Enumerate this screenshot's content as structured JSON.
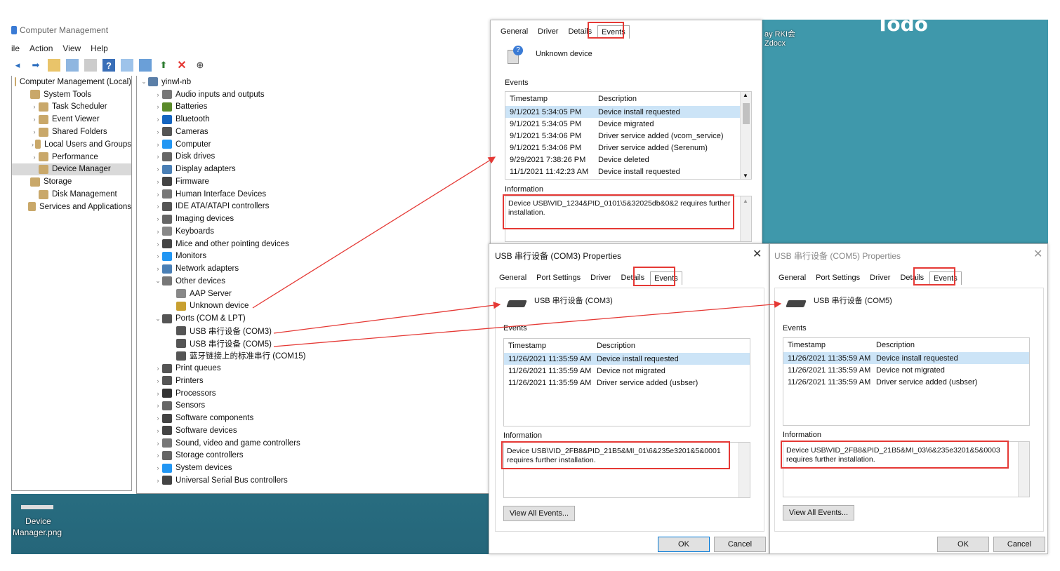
{
  "desktop": {
    "todo": "Todo",
    "icon_label_1": "Device",
    "icon_label_2": "Manager.png",
    "side_text_1": "ay RKI会",
    "side_text_2": "Zdocx"
  },
  "cm": {
    "title": "Computer Management",
    "menu": [
      "ile",
      "Action",
      "View",
      "Help"
    ],
    "left_tree": [
      {
        "label": "Computer Management (Local)",
        "indent": 0,
        "icon": "computer-management-icon"
      },
      {
        "label": "System Tools",
        "indent": 1,
        "icon": "tools-icon"
      },
      {
        "label": "Task Scheduler",
        "indent": 2,
        "icon": "clock-icon",
        "chev": "›"
      },
      {
        "label": "Event Viewer",
        "indent": 2,
        "icon": "event-viewer-icon",
        "chev": "›"
      },
      {
        "label": "Shared Folders",
        "indent": 2,
        "icon": "shared-folder-icon",
        "chev": "›"
      },
      {
        "label": "Local Users and Groups",
        "indent": 2,
        "icon": "users-icon",
        "chev": "›"
      },
      {
        "label": "Performance",
        "indent": 2,
        "icon": "performance-icon",
        "chev": "›"
      },
      {
        "label": "Device Manager",
        "indent": 2,
        "icon": "device-manager-icon",
        "selected": true
      },
      {
        "label": "Storage",
        "indent": 1,
        "icon": "storage-icon"
      },
      {
        "label": "Disk Management",
        "indent": 2,
        "icon": "disk-icon"
      },
      {
        "label": "Services and Applications",
        "indent": 1,
        "icon": "services-icon"
      }
    ],
    "right_tree": [
      {
        "label": "yinwl-nb",
        "indent": 0,
        "chev": "⌄",
        "color": "#5b7fa8"
      },
      {
        "label": "Audio inputs and outputs",
        "indent": 1,
        "chev": "›",
        "color": "#777"
      },
      {
        "label": "Batteries",
        "indent": 1,
        "chev": "›",
        "color": "#5a8a2a"
      },
      {
        "label": "Bluetooth",
        "indent": 1,
        "chev": "›",
        "color": "#1565c0"
      },
      {
        "label": "Cameras",
        "indent": 1,
        "chev": "›",
        "color": "#555"
      },
      {
        "label": "Computer",
        "indent": 1,
        "chev": "›",
        "color": "#2196f3"
      },
      {
        "label": "Disk drives",
        "indent": 1,
        "chev": "›",
        "color": "#666"
      },
      {
        "label": "Display adapters",
        "indent": 1,
        "chev": "›",
        "color": "#4a7fb5"
      },
      {
        "label": "Firmware",
        "indent": 1,
        "chev": "›",
        "color": "#444"
      },
      {
        "label": "Human Interface Devices",
        "indent": 1,
        "chev": "›",
        "color": "#777"
      },
      {
        "label": "IDE ATA/ATAPI controllers",
        "indent": 1,
        "chev": "›",
        "color": "#555"
      },
      {
        "label": "Imaging devices",
        "indent": 1,
        "chev": "›",
        "color": "#666"
      },
      {
        "label": "Keyboards",
        "indent": 1,
        "chev": "›",
        "color": "#888"
      },
      {
        "label": "Mice and other pointing devices",
        "indent": 1,
        "chev": "›",
        "color": "#444"
      },
      {
        "label": "Monitors",
        "indent": 1,
        "chev": "›",
        "color": "#2196f3"
      },
      {
        "label": "Network adapters",
        "indent": 1,
        "chev": "›",
        "color": "#4a7fb5"
      },
      {
        "label": "Other devices",
        "indent": 1,
        "chev": "⌄",
        "color": "#777"
      },
      {
        "label": "AAP Server",
        "indent": 2,
        "chev": "",
        "color": "#888"
      },
      {
        "label": "Unknown device",
        "indent": 2,
        "chev": "",
        "color": "#c8a030"
      },
      {
        "label": "Ports (COM & LPT)",
        "indent": 1,
        "chev": "⌄",
        "color": "#555"
      },
      {
        "label": "USB 串行设备 (COM3)",
        "indent": 2,
        "chev": "",
        "color": "#555"
      },
      {
        "label": "USB 串行设备 (COM5)",
        "indent": 2,
        "chev": "",
        "color": "#555"
      },
      {
        "label": "蓝牙链接上的标准串行 (COM15)",
        "indent": 2,
        "chev": "",
        "color": "#555"
      },
      {
        "label": "Print queues",
        "indent": 1,
        "chev": "›",
        "color": "#555"
      },
      {
        "label": "Printers",
        "indent": 1,
        "chev": "›",
        "color": "#555"
      },
      {
        "label": "Processors",
        "indent": 1,
        "chev": "›",
        "color": "#333"
      },
      {
        "label": "Sensors",
        "indent": 1,
        "chev": "›",
        "color": "#666"
      },
      {
        "label": "Software components",
        "indent": 1,
        "chev": "›",
        "color": "#444"
      },
      {
        "label": "Software devices",
        "indent": 1,
        "chev": "›",
        "color": "#444"
      },
      {
        "label": "Sound, video and game controllers",
        "indent": 1,
        "chev": "›",
        "color": "#777"
      },
      {
        "label": "Storage controllers",
        "indent": 1,
        "chev": "›",
        "color": "#666"
      },
      {
        "label": "System devices",
        "indent": 1,
        "chev": "›",
        "color": "#2196f3"
      },
      {
        "label": "Universal Serial Bus controllers",
        "indent": 1,
        "chev": "›",
        "color": "#444"
      }
    ]
  },
  "d1": {
    "tabs": [
      "General",
      "Driver",
      "Details",
      "Events"
    ],
    "device": "Unknown device",
    "events_label": "Events",
    "col_ts": "Timestamp",
    "col_desc": "Description",
    "rows": [
      {
        "ts": "9/1/2021 5:34:05 PM",
        "desc": "Device install requested"
      },
      {
        "ts": "9/1/2021 5:34:05 PM",
        "desc": "Device migrated"
      },
      {
        "ts": "9/1/2021 5:34:06 PM",
        "desc": "Driver service added (vcom_service)"
      },
      {
        "ts": "9/1/2021 5:34:06 PM",
        "desc": "Driver service added (Serenum)"
      },
      {
        "ts": "9/29/2021 7:38:26 PM",
        "desc": "Device deleted"
      },
      {
        "ts": "11/1/2021 11:42:23 AM",
        "desc": "Device install requested"
      }
    ],
    "info_label": "Information",
    "info": "Device USB\\VID_1234&PID_0101\\5&32025db&0&2 requires further installation."
  },
  "d2": {
    "title": "USB 串行设备 (COM3) Properties",
    "tabs": [
      "General",
      "Port Settings",
      "Driver",
      "Details",
      "Events"
    ],
    "device": "USB 串行设备 (COM3)",
    "events_label": "Events",
    "col_ts": "Timestamp",
    "col_desc": "Description",
    "rows": [
      {
        "ts": "11/26/2021 11:35:59 AM",
        "desc": "Device install requested"
      },
      {
        "ts": "11/26/2021 11:35:59 AM",
        "desc": "Device not migrated"
      },
      {
        "ts": "11/26/2021 11:35:59 AM",
        "desc": "Driver service added (usbser)"
      }
    ],
    "info_label": "Information",
    "info": "Device USB\\VID_2FB8&PID_21B5&MI_01\\6&235e3201&5&0001 requires further installation.",
    "view_all": "View All Events...",
    "ok": "OK",
    "cancel": "Cancel"
  },
  "d3": {
    "title": "USB 串行设备 (COM5) Properties",
    "tabs": [
      "General",
      "Port Settings",
      "Driver",
      "Details",
      "Events"
    ],
    "device": "USB 串行设备 (COM5)",
    "events_label": "Events",
    "col_ts": "Timestamp",
    "col_desc": "Description",
    "rows": [
      {
        "ts": "11/26/2021 11:35:59 AM",
        "desc": "Device install requested"
      },
      {
        "ts": "11/26/2021 11:35:59 AM",
        "desc": "Device not migrated"
      },
      {
        "ts": "11/26/2021 11:35:59 AM",
        "desc": "Driver service added (usbser)"
      }
    ],
    "info_label": "Information",
    "info": "Device USB\\VID_2FB8&PID_21B5&MI_03\\6&235e3201&5&0003 requires further installation.",
    "view_all": "View All Events...",
    "ok": "OK",
    "cancel": "Cancel"
  },
  "colors": {
    "annotation_red": "#e53935",
    "selection": "#cce4f7"
  }
}
